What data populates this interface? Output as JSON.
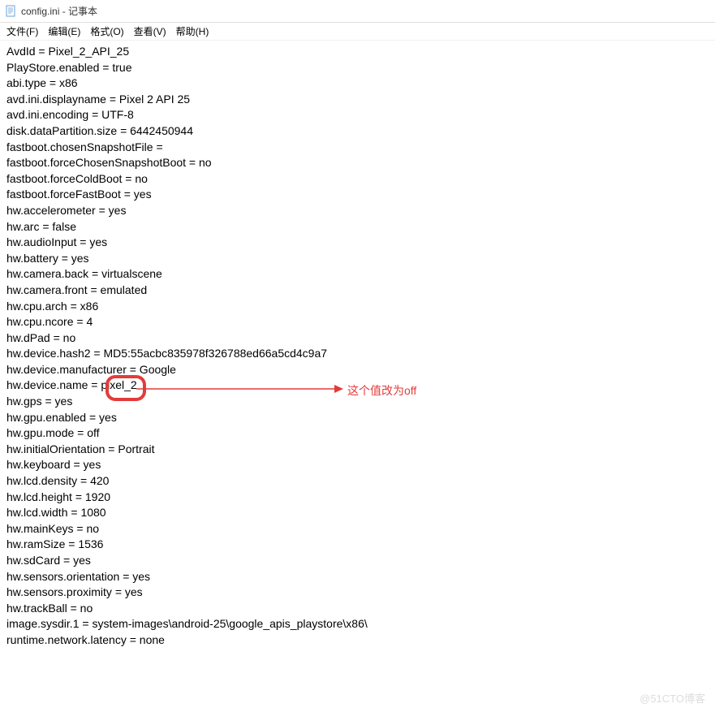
{
  "window": {
    "title": "config.ini - 记事本"
  },
  "menu": {
    "file": "文件(F)",
    "edit": "编辑(E)",
    "format": "格式(O)",
    "view": "查看(V)",
    "help": "帮助(H)"
  },
  "content": {
    "lines": [
      "AvdId = Pixel_2_API_25",
      "PlayStore.enabled = true",
      "abi.type = x86",
      "avd.ini.displayname = Pixel 2 API 25",
      "avd.ini.encoding = UTF-8",
      "disk.dataPartition.size = 6442450944",
      "fastboot.chosenSnapshotFile =",
      "fastboot.forceChosenSnapshotBoot = no",
      "fastboot.forceColdBoot = no",
      "fastboot.forceFastBoot = yes",
      "hw.accelerometer = yes",
      "hw.arc = false",
      "hw.audioInput = yes",
      "hw.battery = yes",
      "hw.camera.back = virtualscene",
      "hw.camera.front = emulated",
      "hw.cpu.arch = x86",
      "hw.cpu.ncore = 4",
      "hw.dPad = no",
      "hw.device.hash2 = MD5:55acbc835978f326788ed66a5cd4c9a7",
      "hw.device.manufacturer = Google",
      "hw.device.name = pixel_2",
      "hw.gps = yes",
      "hw.gpu.enabled = yes",
      "hw.gpu.mode = off",
      "hw.initialOrientation = Portrait",
      "hw.keyboard = yes",
      "hw.lcd.density = 420",
      "hw.lcd.height = 1920",
      "hw.lcd.width = 1080",
      "hw.mainKeys = no",
      "hw.ramSize = 1536",
      "hw.sdCard = yes",
      "hw.sensors.orientation = yes",
      "hw.sensors.proximity = yes",
      "hw.trackBall = no",
      "image.sysdir.1 = system-images\\android-25\\google_apis_playstore\\x86\\",
      "runtime.network.latency = none"
    ]
  },
  "annotation": {
    "text": "这个值改为off"
  },
  "watermark": "@51CTO博客"
}
